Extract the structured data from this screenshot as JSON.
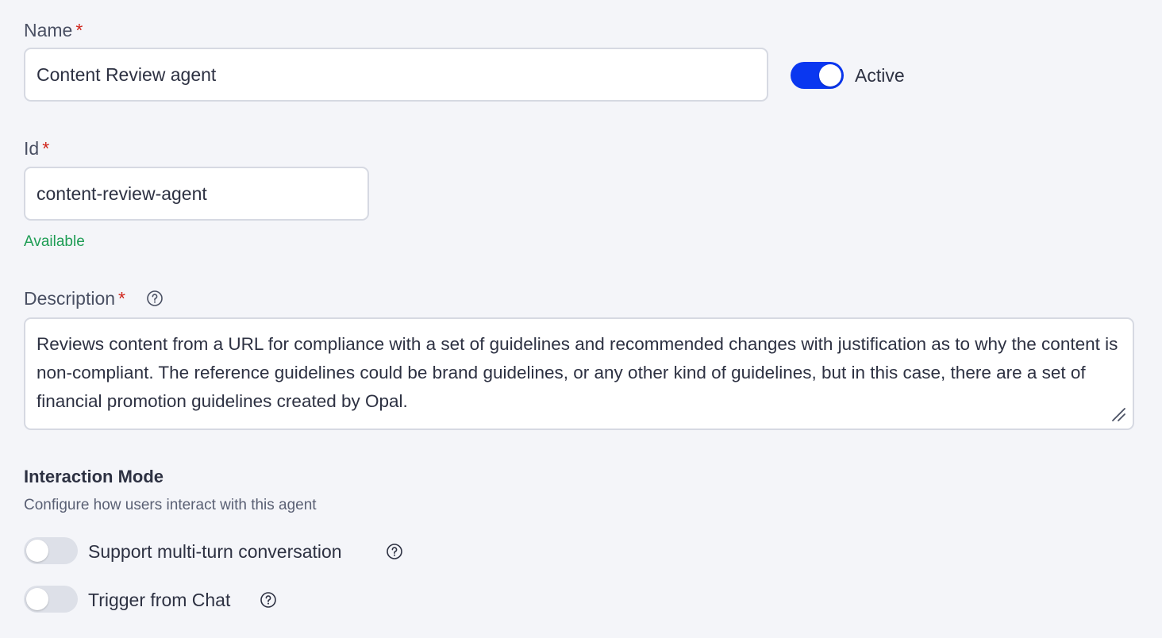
{
  "name_field": {
    "label": "Name",
    "required_mark": "*",
    "value": "Content Review agent"
  },
  "active_toggle": {
    "label": "Active",
    "state": "on",
    "color": "#0a37f0"
  },
  "id_field": {
    "label": "Id",
    "required_mark": "*",
    "value": "content-review-agent",
    "status": "Available",
    "status_color": "#1f9d55"
  },
  "description_field": {
    "label": "Description",
    "required_mark": "*",
    "help_icon": "question-circle-icon",
    "value": "Reviews content from a URL for compliance with a set of guidelines and recommended changes with justification as to why the content is non-compliant. The reference guidelines could be brand guidelines, or any other kind of guidelines, but in this case, there are a set of financial promotion guidelines created by Opal."
  },
  "interaction_mode": {
    "title": "Interaction Mode",
    "subtitle": "Configure how users interact with this agent",
    "options": [
      {
        "label": "Support multi-turn conversation",
        "state": "off",
        "help_icon": "question-circle-icon"
      },
      {
        "label": "Trigger from Chat",
        "state": "off",
        "help_icon": "question-circle-icon"
      }
    ]
  }
}
